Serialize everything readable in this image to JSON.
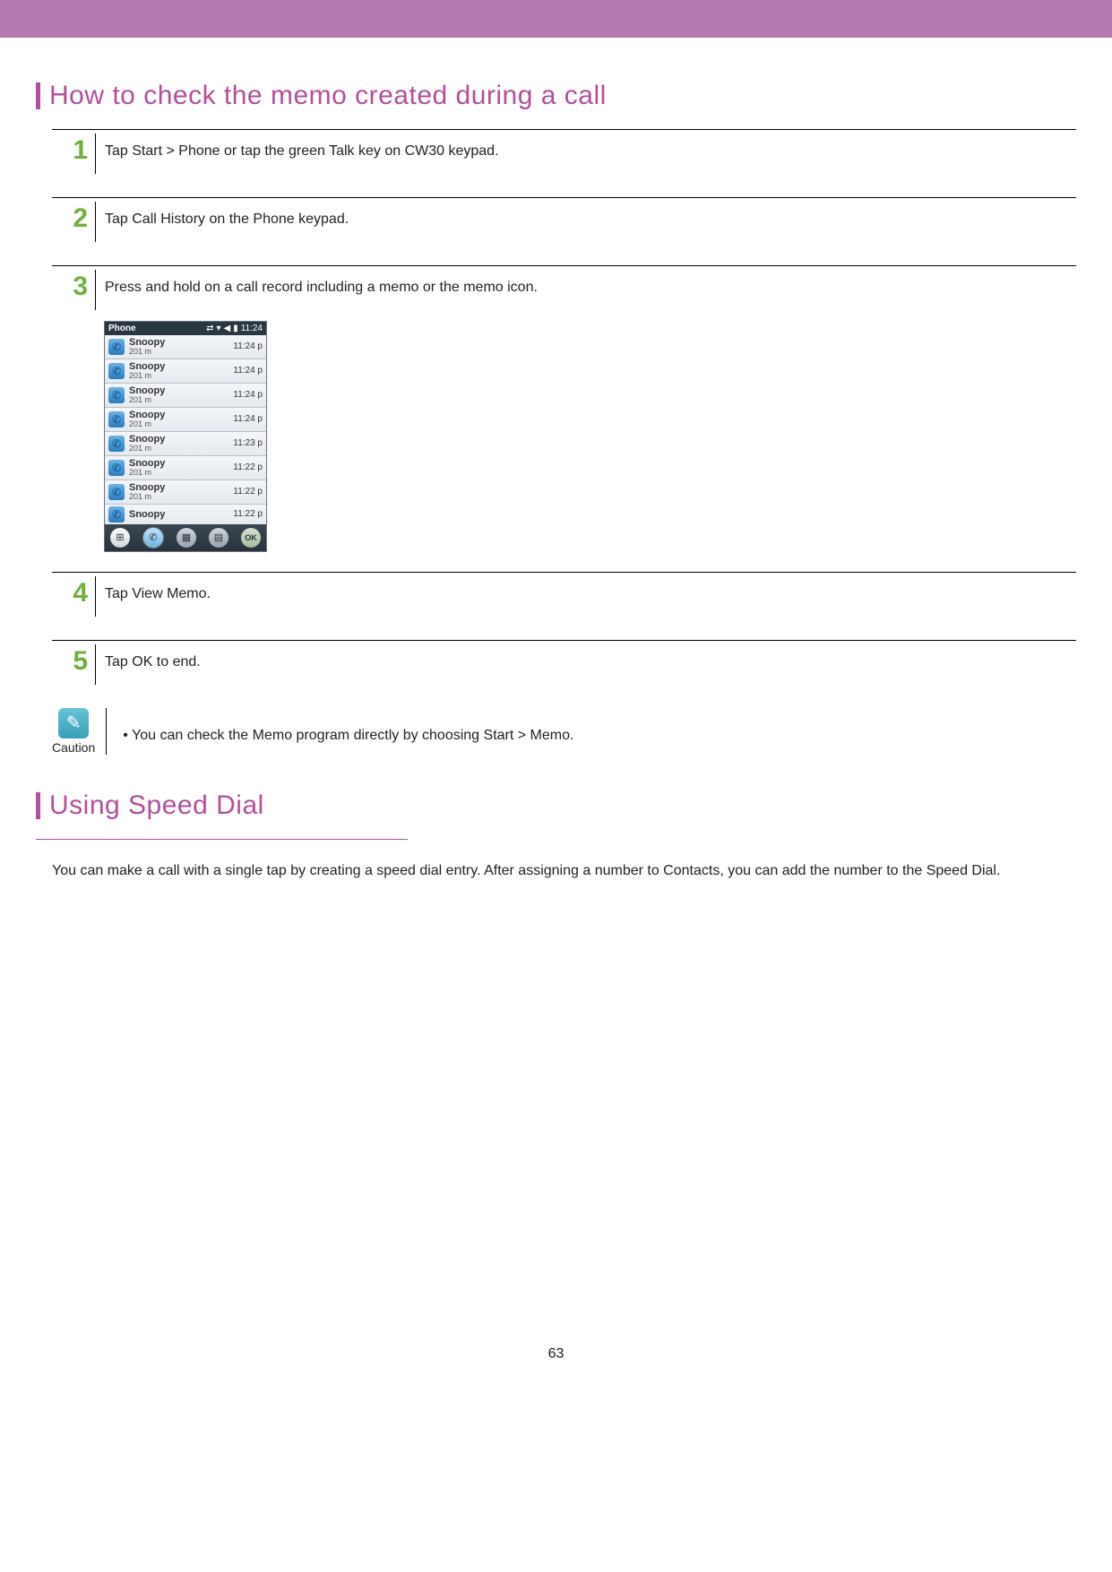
{
  "section1": {
    "title": "How to check the memo created during a call"
  },
  "steps": {
    "s1": {
      "num": "1",
      "text": "Tap Start > Phone or tap the green Talk key on CW30 keypad."
    },
    "s2": {
      "num": "2",
      "text": "Tap Call History on the Phone keypad."
    },
    "s3": {
      "num": "3",
      "text": "Press and hold on a call record including a memo or the memo icon."
    },
    "s4": {
      "num": "4",
      "text": "Tap View Memo."
    },
    "s5": {
      "num": "5",
      "text": "Tap OK to end."
    }
  },
  "phone": {
    "title": "Phone",
    "clock": "11:24",
    "rows": [
      {
        "name": "Snoopy",
        "sub": "201 m",
        "time": "11:24 p"
      },
      {
        "name": "Snoopy",
        "sub": "201 m",
        "time": "11:24 p"
      },
      {
        "name": "Snoopy",
        "sub": "201 m",
        "time": "11:24 p"
      },
      {
        "name": "Snoopy",
        "sub": "201 m",
        "time": "11:24 p"
      },
      {
        "name": "Snoopy",
        "sub": "201 m",
        "time": "11:23 p"
      },
      {
        "name": "Snoopy",
        "sub": "201 m",
        "time": "11:22 p"
      },
      {
        "name": "Snoopy",
        "sub": "201 m",
        "time": "11:22 p"
      },
      {
        "name": "Snoopy",
        "sub": "",
        "time": "11:22 p"
      }
    ],
    "okLabel": "OK"
  },
  "caution": {
    "label": "Caution",
    "text": "•  You can check the Memo program directly by choosing Start > Memo."
  },
  "section2": {
    "title": "Using Speed Dial",
    "para": "You can make a call with a single tap by creating a speed dial entry. After assigning a number to Contacts, you can add the number to the Speed Dial."
  },
  "pageNumber": "63"
}
